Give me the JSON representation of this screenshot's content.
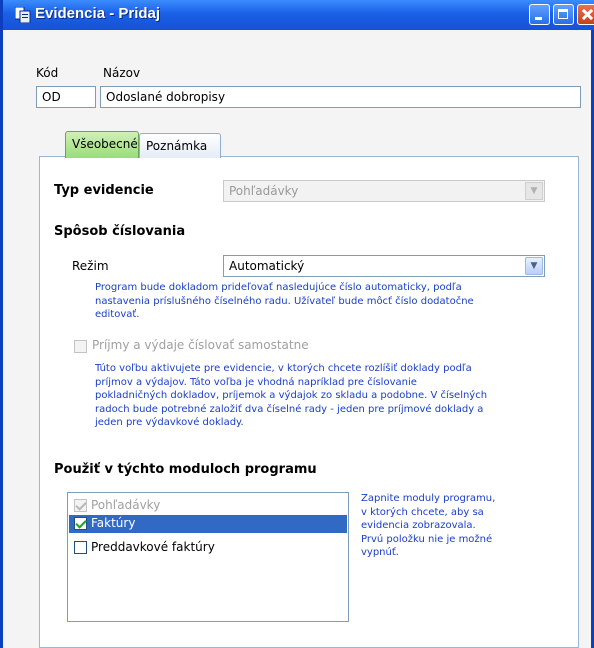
{
  "window": {
    "title": "Evidencia - Pridaj",
    "controls": {
      "minimize": "minimize-icon",
      "maximize": "maximize-icon",
      "close": "close-icon"
    }
  },
  "header": {
    "kod_label": "Kód",
    "kod_value": "OD",
    "nazov_label": "Názov",
    "nazov_value": "Odoslané dobropisy"
  },
  "tabs": [
    {
      "label": "Všeobecné",
      "active": true
    },
    {
      "label": "Poznámka",
      "active": false
    }
  ],
  "general": {
    "typ_label": "Typ evidencie",
    "typ_value": "Pohľadávky",
    "sposob_heading": "Spôsob číslovania",
    "rezim_label": "Režim",
    "rezim_value": "Automatický",
    "rezim_help": [
      "Program bude dokladom prideľovať nasledujúce číslo automaticky, podľa",
      "nastavenia príslušného číselného radu. Užívateľ bude môcť číslo dodatočne",
      "editovať."
    ],
    "prijmy_checkbox": "Príjmy a výdaje číslovať samostatne",
    "prijmy_help": [
      "Túto voľbu aktivujete pre evidencie, v ktorých chcete rozlíšiť doklady podľa",
      "príjmov a výdajov. Táto voľba je vhodná napríklad pre číslovanie",
      "pokladničných dokladov, príjemok a výdajok zo skladu a podobne. V číselných",
      "radoch bude potrebné založiť dva číselné rady - jeden pre príjmové doklady a",
      "jeden pre výdavkové doklady."
    ],
    "moduly_heading": "Použiť v týchto moduloch programu",
    "moduly_items": [
      {
        "label": "Pohľadávky",
        "checked": true,
        "disabled": true,
        "selected": false
      },
      {
        "label": "Faktúry",
        "checked": true,
        "disabled": false,
        "selected": true
      },
      {
        "label": "Preddavkové faktúry",
        "checked": false,
        "disabled": false,
        "selected": false
      }
    ],
    "moduly_help": [
      "Zapnite moduly programu,",
      "v ktorých chcete, aby sa",
      "evidencia zobrazovala.",
      "Prvú položku nie je možné",
      "vypnúť."
    ]
  },
  "colors": {
    "titlebar": "#1a60e6",
    "help_text": "#1a3ec8",
    "selection": "#316ac5",
    "active_tab": "#9bdc78"
  }
}
